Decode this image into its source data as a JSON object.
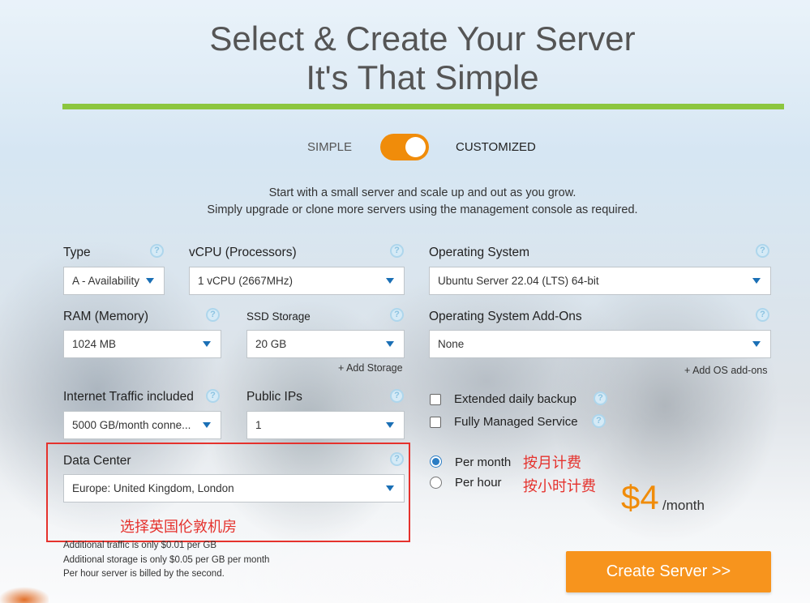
{
  "header": {
    "title_line1": "Select & Create Your Server",
    "title_line2": "It's That Simple"
  },
  "mode_toggle": {
    "left_label": "SIMPLE",
    "right_label": "CUSTOMIZED",
    "selected": "CUSTOMIZED"
  },
  "intro": {
    "line1": "Start with a small server and scale up and out as you grow.",
    "line2": "Simply upgrade or clone more servers using the management console as required."
  },
  "fields": {
    "type": {
      "label": "Type",
      "value": "A - Availability"
    },
    "vcpu": {
      "label": "vCPU (Processors)",
      "value": "1 vCPU (2667MHz)"
    },
    "os": {
      "label": "Operating System",
      "value": "Ubuntu Server 22.04 (LTS) 64-bit"
    },
    "ram": {
      "label": "RAM (Memory)",
      "value": "1024 MB"
    },
    "ssd": {
      "label": "SSD Storage",
      "value": "20 GB"
    },
    "os_addons": {
      "label": "Operating System Add-Ons",
      "value": "None"
    },
    "traffic": {
      "label": "Internet Traffic included",
      "value": "5000 GB/month conne..."
    },
    "public_ips": {
      "label": "Public IPs",
      "value": "1"
    },
    "datacenter": {
      "label": "Data Center",
      "value": "Europe: United Kingdom, London"
    }
  },
  "links": {
    "add_storage": "+ Add Storage",
    "add_os_addons": "+ Add OS add-ons"
  },
  "help_glyph": "?",
  "options": {
    "backup": {
      "label": "Extended daily backup",
      "checked": false
    },
    "managed": {
      "label": "Fully Managed Service",
      "checked": false
    }
  },
  "billing": {
    "per_month": "Per month",
    "per_hour": "Per hour",
    "selected": "Per month"
  },
  "annotations": {
    "per_month_note": "按月计费",
    "per_hour_note": "按小时计费",
    "datacenter_note": "选择英国伦敦机房"
  },
  "price": {
    "amount": "$4",
    "unit": "/month"
  },
  "notes": {
    "traffic": "Additional traffic is only $0.01 per GB",
    "storage": "Additional storage is only $0.05 per GB per month",
    "hourly": "Per hour server is billed by the second."
  },
  "cta": {
    "label": "Create Server >>"
  },
  "colors": {
    "accent_orange": "#f7941d",
    "rule_green": "#8cc63f",
    "caret_blue": "#1a6fb5",
    "annotation_red": "#e5322d"
  }
}
